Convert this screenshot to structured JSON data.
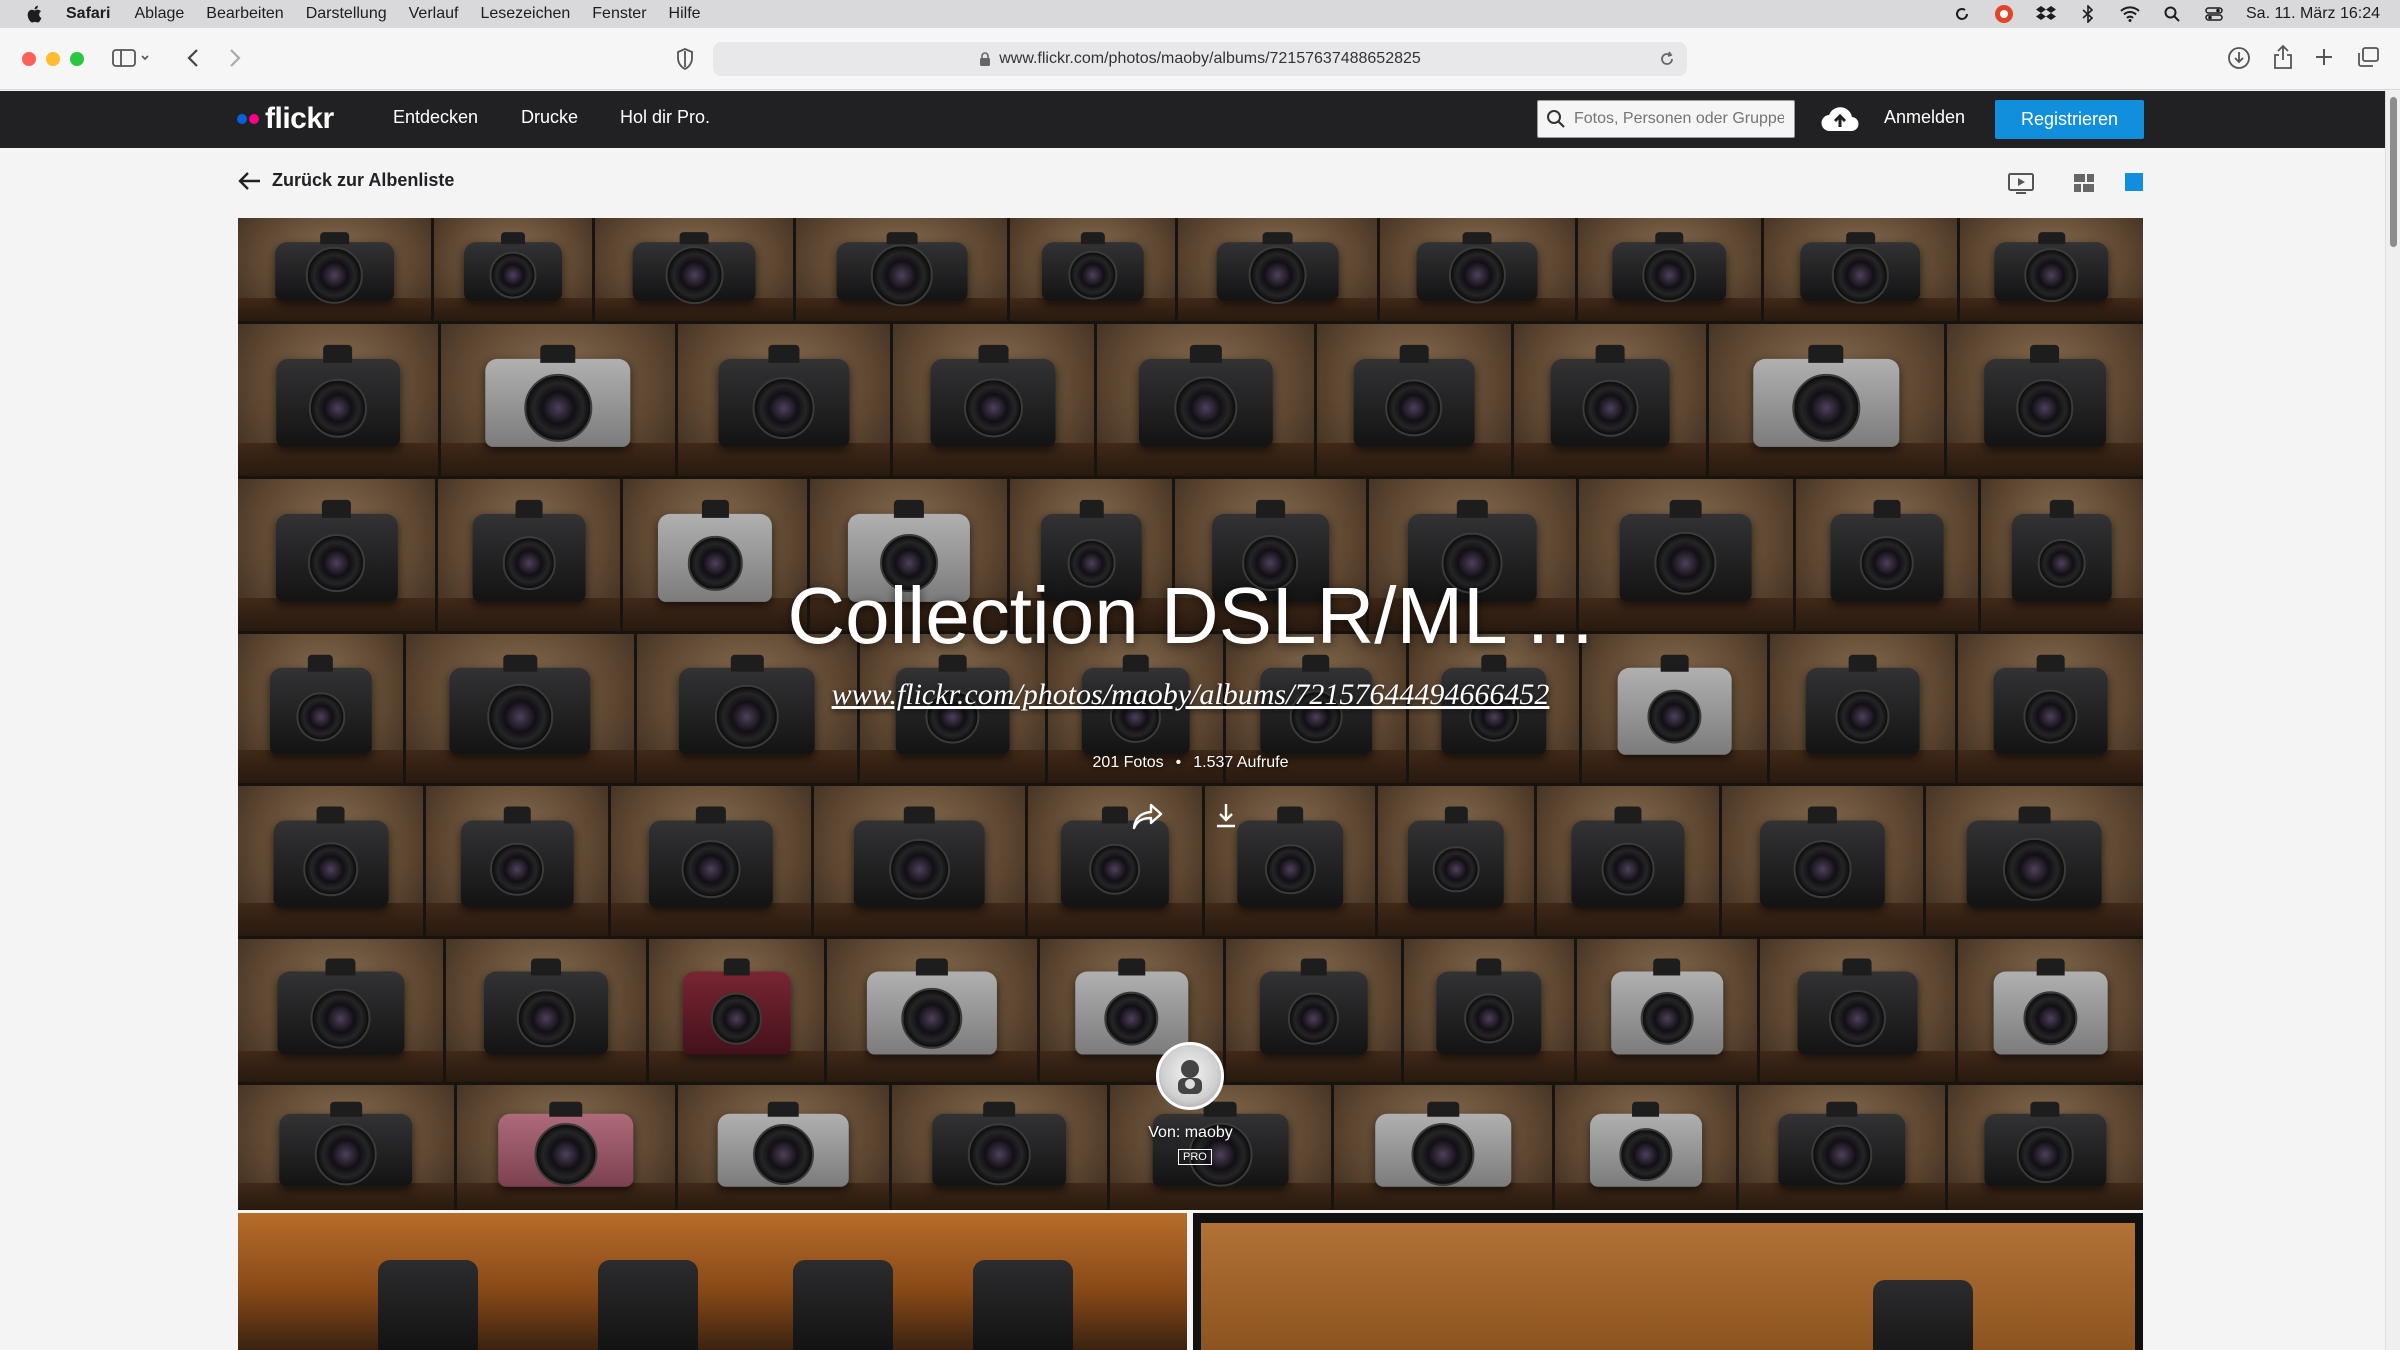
{
  "menubar": {
    "app_name": "Safari",
    "menus": [
      "Ablage",
      "Bearbeiten",
      "Darstellung",
      "Verlauf",
      "Lesezeichen",
      "Fenster",
      "Hilfe"
    ],
    "datetime": "Sa. 11. März  16:24"
  },
  "browser": {
    "url": "www.flickr.com/photos/maoby/albums/72157637488652825"
  },
  "flickr_nav": {
    "logo": "flickr",
    "links": [
      "Entdecken",
      "Drucke",
      "Hol dir Pro."
    ],
    "search_placeholder": "Fotos, Personen oder Gruppen",
    "login": "Anmelden",
    "signup": "Registrieren"
  },
  "subbar": {
    "back_label": "Zurück zur Albenliste"
  },
  "album": {
    "title": "Collection DSLR/ML ...",
    "description": "www.flickr.com/photos/maoby/albums/72157644494666452",
    "photo_count": "201 Fotos",
    "views": "1.537 Aufrufe",
    "owner_label": "Von: maoby",
    "pro_badge": "PRO"
  },
  "colors": {
    "flickr_nav_bg": "#212124",
    "signup_button": "#128fdc",
    "flickr_blue": "#0063dc",
    "flickr_pink": "#ff0084",
    "active_view": "#128fdc"
  }
}
